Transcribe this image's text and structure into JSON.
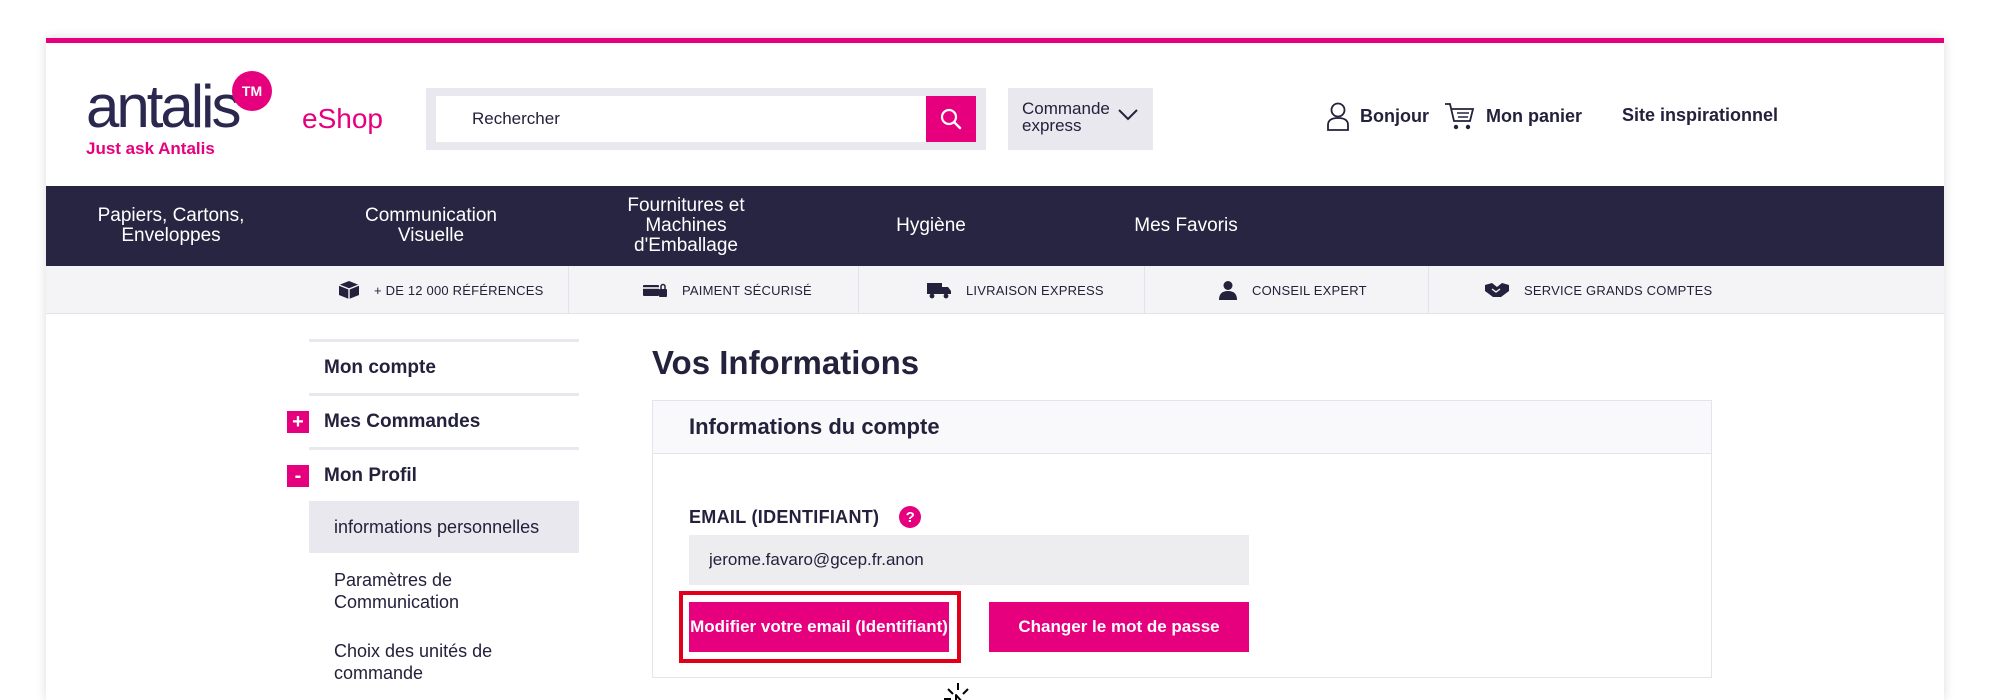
{
  "colors": {
    "brand_pink": "#e6007e",
    "nav_dark": "#272541",
    "text_dark": "#23213b",
    "highlight_red": "#e0001a"
  },
  "header": {
    "logo_word": "antalis",
    "logo_badge": "TM",
    "logo_tagline": "Just ask Antalis",
    "eshop": "eShop",
    "search_placeholder": "Rechercher",
    "express_line1": "Commande",
    "express_line2": "express",
    "bonjour": "Bonjour",
    "panier": "Mon panier",
    "site": "Site inspirationnel"
  },
  "nav": {
    "items": [
      {
        "line1": "Papiers, Cartons,",
        "line2": "Enveloppes",
        "line3": ""
      },
      {
        "line1": "Communication",
        "line2": "Visuelle",
        "line3": ""
      },
      {
        "line1": "Fournitures et",
        "line2": "Machines",
        "line3": "d'Emballage"
      },
      {
        "line1": "Hygiène",
        "line2": "",
        "line3": ""
      },
      {
        "line1": "Mes Favoris",
        "line2": "",
        "line3": ""
      }
    ]
  },
  "benefits": {
    "items": [
      {
        "label": "+ DE 12 000 RÉFÉRENCES",
        "icon": "box-icon"
      },
      {
        "label": "PAIMENT SÉCURISÉ",
        "icon": "card-lock-icon"
      },
      {
        "label": "LIVRAISON EXPRESS",
        "icon": "truck-icon"
      },
      {
        "label": "CONSEIL EXPERT",
        "icon": "person-icon"
      },
      {
        "label": "SERVICE GRANDS COMPTES",
        "icon": "handshake-icon"
      }
    ]
  },
  "sidebar": {
    "mon_compte": "Mon compte",
    "mes_commandes": "Mes Commandes",
    "mes_commandes_toggle": "+",
    "mon_profil": "Mon Profil",
    "mon_profil_toggle": "-",
    "sub_items": [
      "informations personnelles",
      "Paramètres de Communication",
      "Choix des unités de commande"
    ]
  },
  "main": {
    "title": "Vos Informations",
    "panel_title": "Informations du compte",
    "email_label": "EMAIL (IDENTIFIANT)",
    "help": "?",
    "email_value": "jerome.favaro@gcep.fr.anon",
    "modify_button": "Modifier votre email (Identifiant)",
    "password_button": "Changer le mot de passe"
  }
}
